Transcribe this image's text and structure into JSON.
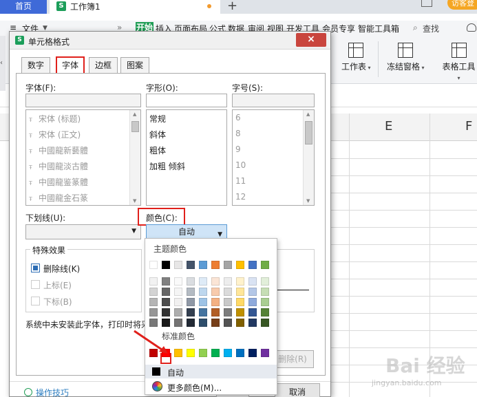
{
  "browser_tabs": {
    "home": "首页",
    "book": "工作簿1",
    "add": "+",
    "login": "访客登"
  },
  "menu": {
    "file": "文件",
    "start": "开始",
    "items": [
      "插入",
      "页面布局",
      "公式",
      "数据",
      "审阅",
      "视图",
      "开发工具",
      "会员专享",
      "智能工具箱"
    ],
    "search": "查找"
  },
  "ribbon": {
    "worksheet": "工作表",
    "freeze": "冻结窗格",
    "table_tools": "表格工具"
  },
  "columns": [
    "E",
    "F"
  ],
  "dialog": {
    "title": "单元格格式",
    "close": "×",
    "tabs": [
      "数字",
      "字体",
      "边框",
      "图案"
    ],
    "font_label": "字体(F):",
    "style_label": "字形(O):",
    "size_label": "字号(S):",
    "fonts": [
      "宋体 (标题)",
      "宋体 (正文)",
      "中國龍新藝體",
      "中國龍淡古體",
      "中國龍鉴篆體",
      "中國龍金石篆"
    ],
    "styles": [
      "常规",
      "斜体",
      "粗体",
      "加粗 倾斜"
    ],
    "sizes": [
      "6",
      "8",
      "9",
      "10",
      "11",
      "12"
    ],
    "underline_label": "下划线(U):",
    "color_label": "颜色(C):",
    "color_value": "自动",
    "effects_title": "特殊效果",
    "strikethrough": "删除线(K)",
    "superscript": "上标(E)",
    "subscript": "下标(B)",
    "note": "系统中未安装此字体，打印时将采",
    "delete_btn": "删除(R)",
    "tips": "操作技巧",
    "cancel": "取消"
  },
  "picker": {
    "theme_title": "主题颜色",
    "standard_title": "标准颜色",
    "auto": "自动",
    "more": "更多颜色(M)...",
    "theme_top": [
      "#ffffff",
      "#000000",
      "#e7e6e6",
      "#44546a",
      "#5b9bd5",
      "#ed7d31",
      "#a5a5a5",
      "#ffc000",
      "#4472c4",
      "#70ad47"
    ],
    "standard": [
      "#c00000",
      "#ff0000",
      "#ffc000",
      "#ffff00",
      "#92d050",
      "#00b050",
      "#00b0f0",
      "#0070c0",
      "#002060",
      "#7030a0"
    ]
  },
  "watermark": {
    "main": "Bai 经验",
    "sub": "jingyan.baidu.com"
  }
}
